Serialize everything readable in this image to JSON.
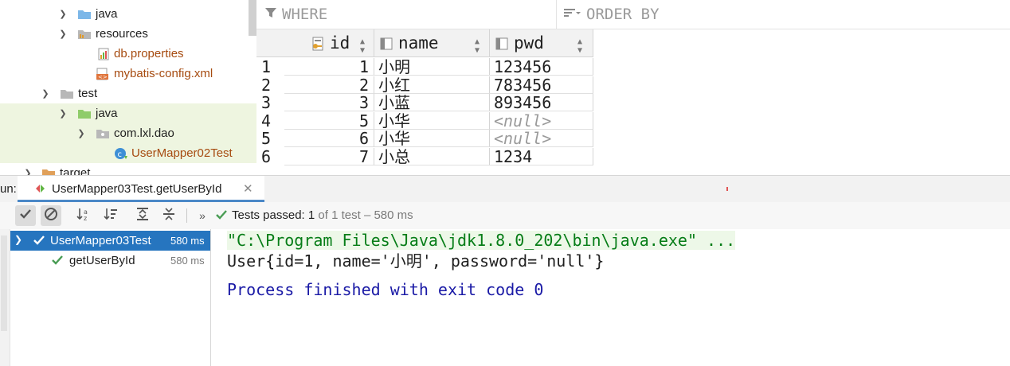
{
  "project_tree": {
    "items": [
      {
        "label": "java",
        "icon": "source-folder-icon",
        "color": "#1f1f1f"
      },
      {
        "label": "resources",
        "icon": "resources-folder-icon",
        "color": "#1f1f1f"
      },
      {
        "label": "db.properties",
        "icon": "properties-file-icon",
        "color": "#a64b10"
      },
      {
        "label": "mybatis-config.xml",
        "icon": "xml-file-icon",
        "color": "#a64b10"
      },
      {
        "label": "test",
        "icon": "folder-icon",
        "color": "#1f1f1f"
      },
      {
        "label": "java",
        "icon": "test-folder-icon",
        "color": "#1f1f1f"
      },
      {
        "label": "com.lxl.dao",
        "icon": "package-icon",
        "color": "#1f1f1f"
      },
      {
        "label": "UserMapper02Test",
        "icon": "java-class-icon",
        "color": "#a64b10"
      },
      {
        "label": "target",
        "icon": "folder-icon",
        "color": "#1f1f1f"
      }
    ]
  },
  "grid": {
    "where_label": "WHERE",
    "order_by_label": "ORDER BY",
    "columns": [
      "id",
      "name",
      "pwd"
    ],
    "row_numbers": [
      "1",
      "2",
      "3",
      "4",
      "5",
      "6"
    ],
    "rows": [
      {
        "id": "1",
        "name": "小明",
        "pwd": "123456"
      },
      {
        "id": "2",
        "name": "小红",
        "pwd": "783456"
      },
      {
        "id": "3",
        "name": "小蓝",
        "pwd": "893456"
      },
      {
        "id": "5",
        "name": "小华",
        "pwd": "<null>"
      },
      {
        "id": "6",
        "name": "小华",
        "pwd": "<null>"
      },
      {
        "id": "7",
        "name": "小总",
        "pwd": "1234"
      }
    ]
  },
  "run": {
    "label": "un:",
    "tab_title": "UserMapper03Test.getUserById"
  },
  "toolbar": {
    "status_prefix": "Tests passed:",
    "passed": "1",
    "status_suffix": "of 1 test – 580 ms"
  },
  "tests": [
    {
      "name": "UserMapper03Test",
      "time": "580 ms"
    },
    {
      "name": "getUserById",
      "time": "580 ms"
    }
  ],
  "console": {
    "lines": [
      "\"C:\\Program Files\\Java\\jdk1.8.0_202\\bin\\java.exe\" ...",
      "User{id=1, name='小明', password='null'}",
      "",
      "Process finished with exit code 0"
    ]
  },
  "colors": {
    "selection": "#2675bf",
    "pass_green": "#499c54",
    "file_orange": "#a64b10",
    "console_blue": "#1a1aa6",
    "cmd_green": "#067d17"
  }
}
